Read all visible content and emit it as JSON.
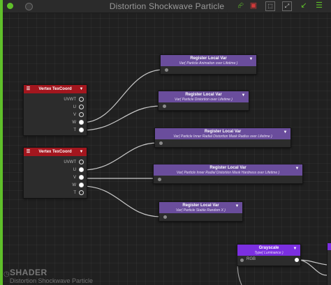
{
  "window": {
    "title": "Distortion Shockwave Particle"
  },
  "toolbar": {
    "left_icons": [
      "status-dot-icon",
      "toggle-dot-icon"
    ],
    "right_icons": [
      "share-icon",
      "camera-icon",
      "frame-icon",
      "fit-icon",
      "arrow-icon",
      "menu-icon"
    ]
  },
  "colors": {
    "register_header": "#6a4d9c",
    "vertex_header": "#a3161e",
    "grayscale_header": "#7b2fe0",
    "accent_green": "#5fbf2a"
  },
  "nodes": {
    "reg1": {
      "title": "Register Local Var",
      "subtitle": "Var( Particle Animation over Lifetime )"
    },
    "reg2": {
      "title": "Register Local Var",
      "subtitle": "Var( Particle Distortion over Lifetime )"
    },
    "reg3": {
      "title": "Register Local Var",
      "subtitle": "Var( Particle Inner Radial Distortion Mask Radius over Lifetime )"
    },
    "reg4": {
      "title": "Register Local Var",
      "subtitle": "Var( Particle Inner Radial Distortion Mask Hardness over Lifetime )"
    },
    "reg5": {
      "title": "Register Local Var",
      "subtitle": "Var( Particle Stable Random X )"
    },
    "vtx1": {
      "title": "Vertex TexCoord",
      "ports": [
        "UVWT",
        "U",
        "V",
        "W",
        "T"
      ]
    },
    "vtx2": {
      "title": "Vertex TexCoord",
      "ports": [
        "UVWT",
        "U",
        "V",
        "W",
        "T"
      ]
    },
    "grayscale": {
      "title": "Grayscale",
      "subtitle": "Type( Luminance )",
      "input": "RGB"
    }
  },
  "watermark": {
    "label": "SHADER",
    "name": "Distortion Shockwave Particle"
  }
}
